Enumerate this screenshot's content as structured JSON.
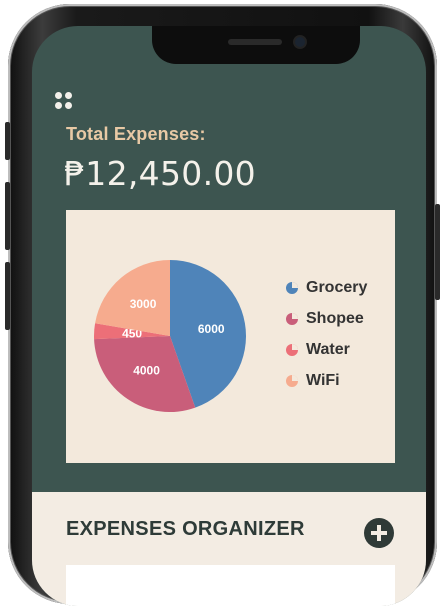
{
  "header": {
    "total_label": "Total Expenses:",
    "total_amount": "₱12,450.00"
  },
  "chart_data": {
    "type": "pie",
    "slices": [
      {
        "name": "Grocery",
        "value": 6000,
        "color": "#4f84b9"
      },
      {
        "name": "Shopee",
        "value": 4000,
        "color": "#c95e7a"
      },
      {
        "name": "Water",
        "value": 450,
        "color": "#ec6f78"
      },
      {
        "name": "WiFi",
        "value": 3000,
        "color": "#f6ab8e"
      }
    ],
    "labels": [
      "6000",
      "4000",
      "450",
      "3000"
    ],
    "legend": [
      "Grocery",
      "Shopee",
      "Water",
      "WiFi"
    ],
    "legend_position": "right"
  },
  "organizer": {
    "title": "EXPENSES ORGANIZER",
    "add_icon": "plus-circle-icon"
  },
  "icons": {
    "menu": "dots-grid-icon"
  }
}
